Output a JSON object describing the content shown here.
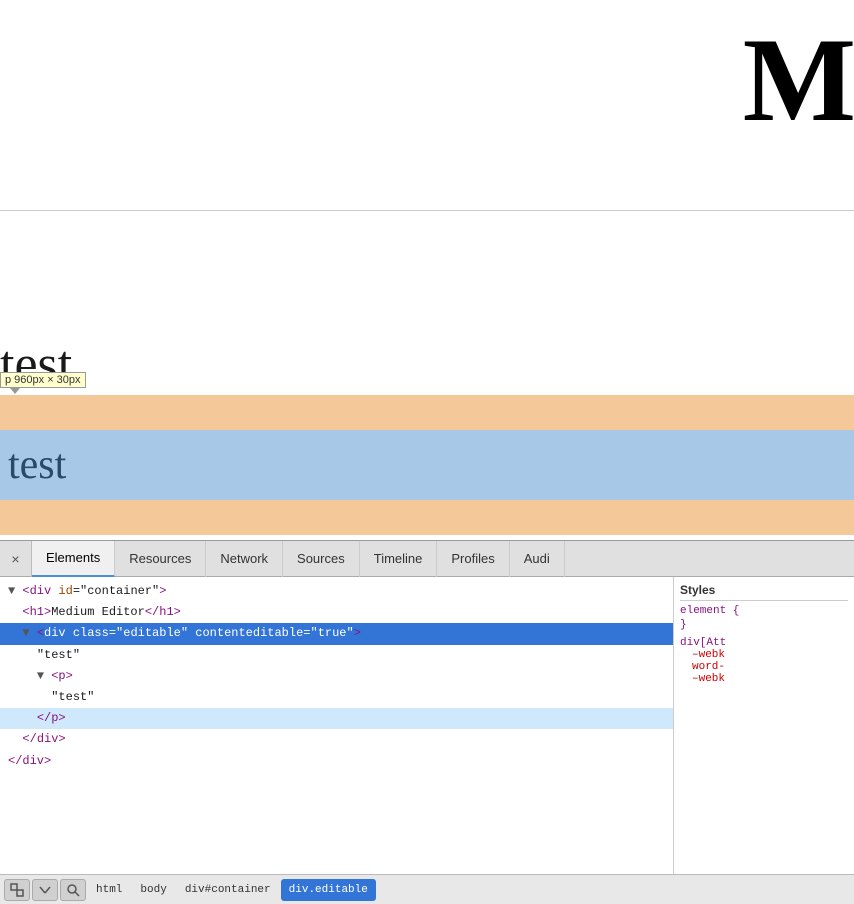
{
  "page": {
    "large_title": "M",
    "heading": "test",
    "tooltip": "p 960px × 30px",
    "blue_text": "test"
  },
  "devtools": {
    "tabs": [
      {
        "label": "×",
        "id": "close"
      },
      {
        "label": "Elements",
        "id": "elements",
        "active": true
      },
      {
        "label": "Resources",
        "id": "resources"
      },
      {
        "label": "Network",
        "id": "network"
      },
      {
        "label": "Sources",
        "id": "sources"
      },
      {
        "label": "Timeline",
        "id": "timeline"
      },
      {
        "label": "Profiles",
        "id": "profiles"
      },
      {
        "label": "Audi",
        "id": "audits"
      }
    ],
    "html": [
      {
        "indent": 0,
        "content": "▼ <div id=\"container\">",
        "type": "open"
      },
      {
        "indent": 1,
        "content": "  <h1>Medium Editor</h1>",
        "type": "tag"
      },
      {
        "indent": 1,
        "content": "  ▼ <div class=\"editable\" contenteditable=\"true\">",
        "type": "open",
        "selected": true
      },
      {
        "indent": 2,
        "content": "    \"test\"",
        "type": "text"
      },
      {
        "indent": 2,
        "content": "    ▼ <p>",
        "type": "open"
      },
      {
        "indent": 3,
        "content": "      \"test\"",
        "type": "text"
      },
      {
        "indent": 2,
        "content": "    </p>",
        "type": "close",
        "hover": true
      },
      {
        "indent": 1,
        "content": "  </div>",
        "type": "close"
      },
      {
        "indent": 0,
        "content": "</div>",
        "type": "close"
      }
    ],
    "styles": {
      "header": "Styles",
      "selector1": "element {",
      "selector1_close": "}",
      "selector2": "div[Att",
      "prop1": "–webk",
      "prop2": "word-",
      "prop3": "–webk"
    },
    "breadcrumb": {
      "items": [
        {
          "label": "html",
          "id": "html-bc"
        },
        {
          "label": "body",
          "id": "body-bc"
        },
        {
          "label": "div#container",
          "id": "container-bc"
        },
        {
          "label": "div.editable",
          "id": "editable-bc",
          "active": true
        }
      ]
    }
  }
}
